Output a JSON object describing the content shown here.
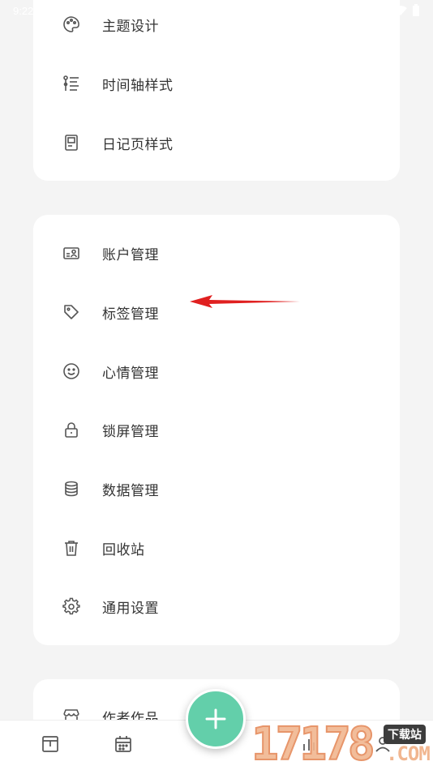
{
  "status_bar": {
    "time": "9:22"
  },
  "settings": {
    "group1": [
      {
        "label": "主题设计",
        "icon": "palette-icon"
      },
      {
        "label": "时间轴样式",
        "icon": "timeline-icon"
      },
      {
        "label": "日记页样式",
        "icon": "page-icon"
      }
    ],
    "group2": [
      {
        "label": "账户管理",
        "icon": "account-icon"
      },
      {
        "label": "标签管理",
        "icon": "tag-icon"
      },
      {
        "label": "心情管理",
        "icon": "smile-icon"
      },
      {
        "label": "锁屏管理",
        "icon": "lock-icon"
      },
      {
        "label": "数据管理",
        "icon": "database-icon"
      },
      {
        "label": "回收站",
        "icon": "trash-icon"
      },
      {
        "label": "通用设置",
        "icon": "gear-icon"
      }
    ],
    "group3": [
      {
        "label": "作者作品",
        "icon": "store-icon"
      }
    ]
  },
  "bottom_nav": {
    "items": [
      {
        "icon": "archive-icon"
      },
      {
        "icon": "calendar-icon"
      },
      {
        "icon": "add-icon"
      },
      {
        "icon": "stats-icon"
      },
      {
        "icon": "profile-icon"
      }
    ]
  },
  "annotation": {
    "arrow_color": "#e02020"
  },
  "watermark": {
    "digits": "17178",
    "badge": "下载站",
    "suffix": ".COM"
  },
  "colors": {
    "accent": "#63cfaa"
  }
}
